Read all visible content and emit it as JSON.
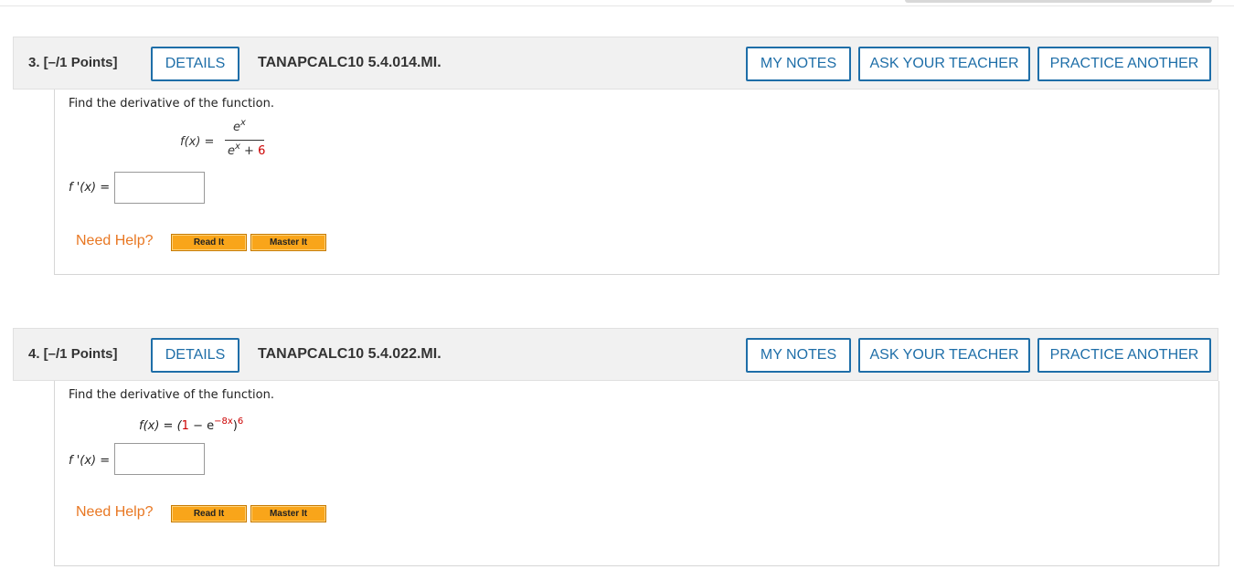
{
  "questions": [
    {
      "number": "3. [–/1 Points]",
      "details_label": "DETAILS",
      "code": "TANAPCALC10 5.4.014.MI.",
      "my_notes_label": "MY NOTES",
      "ask_teacher_label": "ASK YOUR TEACHER",
      "practice_label": "PRACTICE ANOTHER",
      "prompt": "Find the derivative of the function.",
      "function_label": "f(x) =",
      "numerator": "e",
      "numerator_exp": "x",
      "denominator_base": "e",
      "denominator_exp": "x",
      "denominator_rest": " + ",
      "denominator_const": "6",
      "answer_label": "f '(x) =",
      "answer_value": "",
      "need_help": "Need Help?",
      "read_it": "Read It",
      "master_it": "Master It"
    },
    {
      "number": "4. [–/1 Points]",
      "details_label": "DETAILS",
      "code": "TANAPCALC10 5.4.022.MI.",
      "my_notes_label": "MY NOTES",
      "ask_teacher_label": "ASK YOUR TEACHER",
      "practice_label": "PRACTICE ANOTHER",
      "prompt": "Find the derivative of the function.",
      "function_label": "f(x) = (",
      "const_one": "1",
      "minus_e": " − e",
      "exponent": "−8x",
      "close_paren": ")",
      "outer_exp": "6",
      "answer_label": "f '(x) =",
      "answer_value": "",
      "need_help": "Need Help?",
      "read_it": "Read It",
      "master_it": "Master It"
    }
  ]
}
